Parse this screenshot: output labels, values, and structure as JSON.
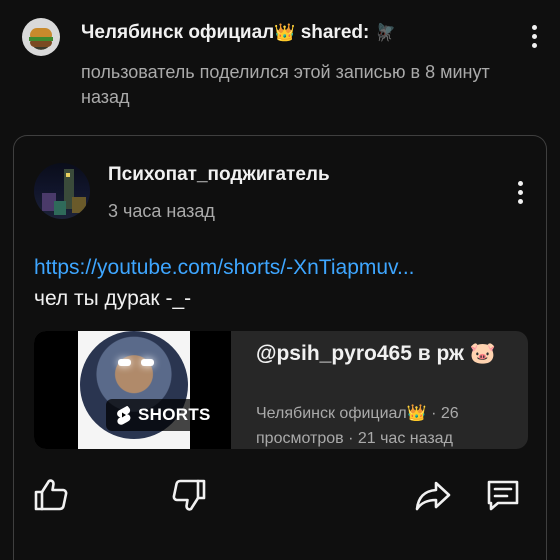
{
  "header": {
    "channel_name": "Челябинск официал",
    "crown_emoji": "👑",
    "shared_label": "shared:",
    "fly_emoji": "🪰",
    "subtitle": "пользователь поделился этой записью в 8 минут назад",
    "avatar_icon": "burger-icon",
    "menu_icon": "more-vert-icon"
  },
  "post": {
    "author": "Психопат_поджигатель",
    "time": "3 часа назад",
    "link": "https://youtube.com/shorts/-XnTiapmuv...",
    "text": "чел ты дурак -_-",
    "menu_icon": "more-vert-icon"
  },
  "video": {
    "badge_label": "SHORTS",
    "title": "@psih_pyro465 в рж 🐷",
    "meta": "Челябинск официал👑 · 26 просмотров · 21 час назад"
  },
  "actions": {
    "like_icon": "thumb-up-icon",
    "dislike_icon": "thumb-down-icon",
    "share_icon": "share-icon",
    "comment_icon": "comment-icon"
  },
  "colors": {
    "background": "#0f0f0f",
    "text": "#f1f1f1",
    "secondary_text": "#aaaaaa",
    "link": "#3ea6ff",
    "card_border": "#3f3f3f",
    "video_card": "#272727"
  }
}
